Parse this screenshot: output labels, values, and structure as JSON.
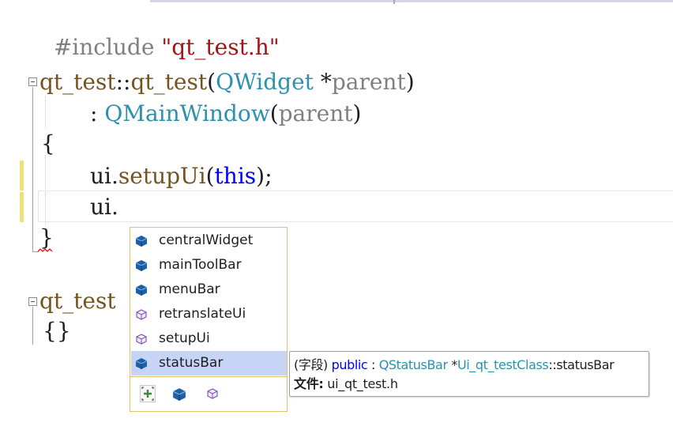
{
  "editor": {
    "include_directive": "#include",
    "include_file": "\"qt_test.h\"",
    "ctor_class": "qt_test",
    "ctor_sep": "::",
    "ctor_name": "qt_test",
    "ctor_open": "(",
    "ctor_param_type": "QWidget",
    "ctor_param_ptr": " *",
    "ctor_param_name": "parent",
    "ctor_close": ")",
    "init_colon": ": ",
    "init_base": "QMainWindow",
    "init_open": "(",
    "init_arg": "parent",
    "init_close": ")",
    "open_brace": "{",
    "setup_obj": "ui",
    "setup_dot": ".",
    "setup_fn": "setupUi",
    "setup_open": "(",
    "setup_arg": "this",
    "setup_close": ");",
    "typing_obj": "ui",
    "typing_dot": ".",
    "close_brace": "}",
    "dtor_partial": "qt_test",
    "dtor_body": "{}"
  },
  "completion": {
    "items": [
      {
        "label": "centralWidget",
        "icon": "field-icon"
      },
      {
        "label": "mainToolBar",
        "icon": "field-icon"
      },
      {
        "label": "menuBar",
        "icon": "field-icon"
      },
      {
        "label": "retranslateUi",
        "icon": "method-icon"
      },
      {
        "label": "setupUi",
        "icon": "method-icon"
      },
      {
        "label": "statusBar",
        "icon": "field-icon"
      }
    ],
    "selected_index": 5,
    "filters": [
      "show-all-filter",
      "field-filter",
      "method-filter"
    ]
  },
  "tooltip": {
    "kind": "(字段)",
    "access": "public",
    "sep": " : ",
    "type": "QStatusBar",
    "ptr": " *",
    "scope_class": "Ui_qt_testClass",
    "scope_sep": "::",
    "member": "statusBar",
    "file_label": "文件:",
    "file_name": " ui_qt_test.h"
  },
  "colors": {
    "type": "#2b91af",
    "string": "#a31515",
    "keyword": "#0000ff",
    "function": "#74531f",
    "preprocessor": "#808080",
    "selection": "#c6d4f5",
    "popup_border": "#e5c365",
    "change_marker": "#efe17a"
  }
}
